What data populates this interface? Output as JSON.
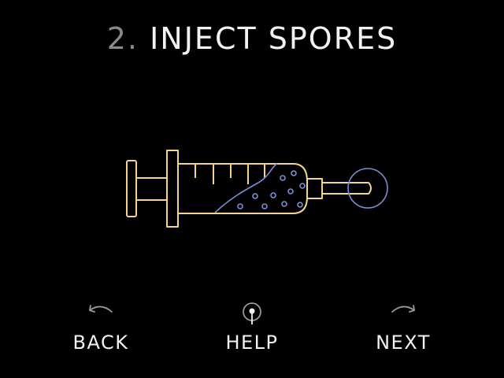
{
  "header": {
    "step_number": "2.",
    "step_title": "INJECT SPORES"
  },
  "illustration": {
    "icon": "syringe-icon",
    "syringe_color": "#f5d58a",
    "spore_color": "#7b8ed6"
  },
  "nav": {
    "back_label": "BACK",
    "help_label": "HELP",
    "next_label": "NEXT",
    "icon_color": "#9a9a9a"
  }
}
